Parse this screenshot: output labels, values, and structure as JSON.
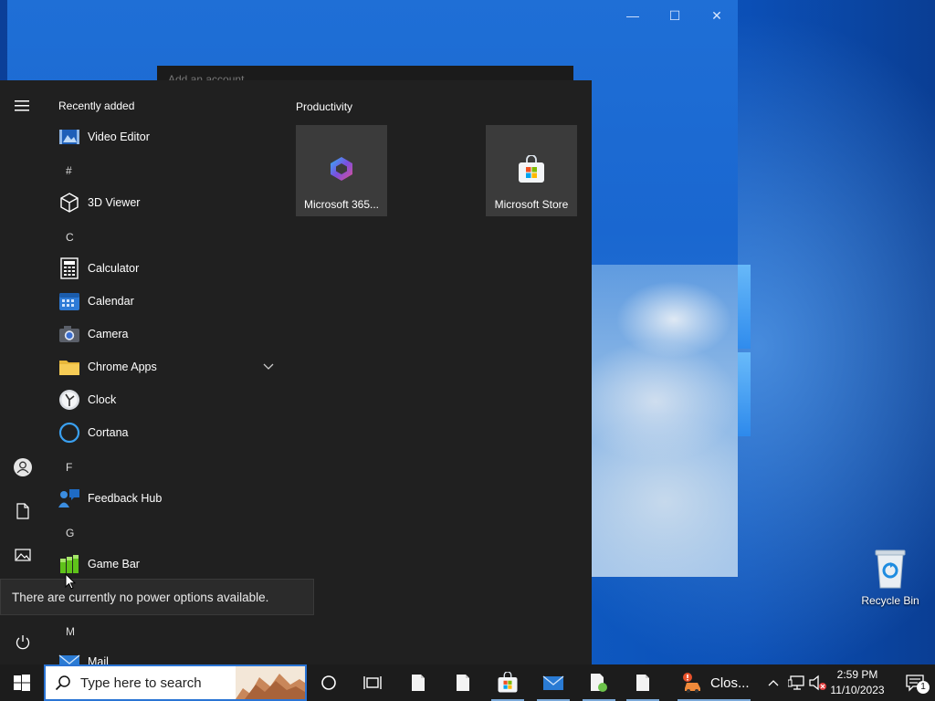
{
  "background_window": {
    "dialog_title": "Add an account",
    "controls": {
      "minimize": "—",
      "maximize": "☐",
      "close": "✕"
    }
  },
  "start_menu": {
    "recently_added_label": "Recently added",
    "apps": [
      {
        "label": "Video Editor",
        "icon": "video-editor-icon"
      },
      {
        "letter": "#"
      },
      {
        "label": "3D Viewer",
        "icon": "cube-icon"
      },
      {
        "letter": "C"
      },
      {
        "label": "Calculator",
        "icon": "calculator-icon"
      },
      {
        "label": "Calendar",
        "icon": "calendar-icon"
      },
      {
        "label": "Camera",
        "icon": "camera-icon"
      },
      {
        "label": "Chrome Apps",
        "icon": "folder-icon",
        "expandable": true
      },
      {
        "label": "Clock",
        "icon": "clock-icon"
      },
      {
        "label": "Cortana",
        "icon": "cortana-icon"
      },
      {
        "letter": "F"
      },
      {
        "label": "Feedback Hub",
        "icon": "feedback-hub-icon"
      },
      {
        "letter": "G"
      },
      {
        "label": "Game Bar",
        "icon": "game-bar-icon"
      },
      {
        "letter": "M"
      },
      {
        "label": "Mail",
        "icon": "mail-icon"
      }
    ],
    "group_title": "Productivity",
    "tiles": [
      {
        "label": "Microsoft 365...",
        "icon": "microsoft-365-icon"
      },
      {
        "label": "Microsoft Store",
        "icon": "microsoft-store-icon"
      }
    ],
    "power_tooltip": "There are currently no power options available."
  },
  "desktop": {
    "recycle_bin_label": "Recycle Bin"
  },
  "taskbar": {
    "search_placeholder": "Type here to search",
    "running_app_label": "Clos...",
    "clock_time": "2:59 PM",
    "clock_date": "11/10/2023",
    "notification_count": "1"
  },
  "colors": {
    "start_bg": "#202020",
    "tile_bg": "#3b3b3b",
    "taskbar_bg": "#1c1c1c",
    "accent": "#2a74d4"
  }
}
